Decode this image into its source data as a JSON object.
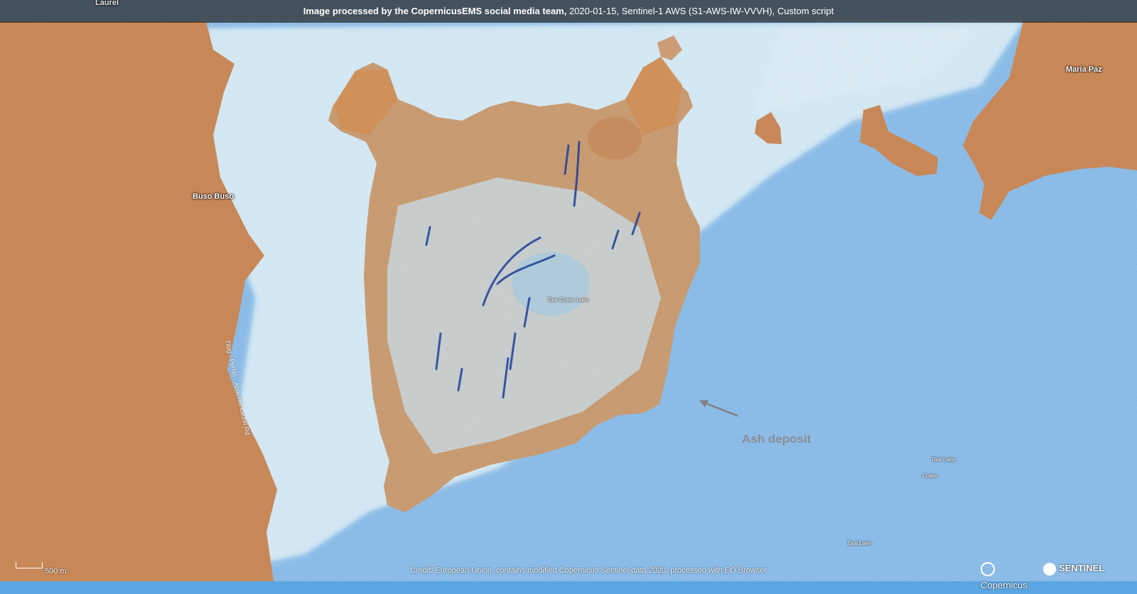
{
  "header": {
    "title_bold": "Image processed by the CopernicusEMS social media team,",
    "title_rest": " 2020-01-15, Sentinel-1 AWS (S1-AWS-IW-VVVH), Custom script"
  },
  "places": {
    "laurel": "Laurel",
    "buso_buso": "Buso Buso",
    "maria_paz": "Maria Paz"
  },
  "water_labels": {
    "crater_lake": "Taal Crater Lake",
    "taal_lake_1": "Taal Lake",
    "taal_lake_2": "l Lake",
    "taal_lake_3": "Taal Lake"
  },
  "road_label": "Tibig - Pertas - Apacible Laurel Rd",
  "annotation": {
    "text": "Ash deposit",
    "arrow_icon": "arrow-icon"
  },
  "scale_bar": {
    "label": "500 m"
  },
  "credit": "Credit: European Union, contains modified Copernicus Sentinel data 2020, processed with EO Browser",
  "logos": {
    "copernicus": "Copernicus",
    "sentinel": "SENTINEL"
  },
  "colors": {
    "water": "#5aa6e0",
    "land": "#d2884b",
    "ash": "#d8ecf4",
    "channel": "#1e3f9a"
  }
}
